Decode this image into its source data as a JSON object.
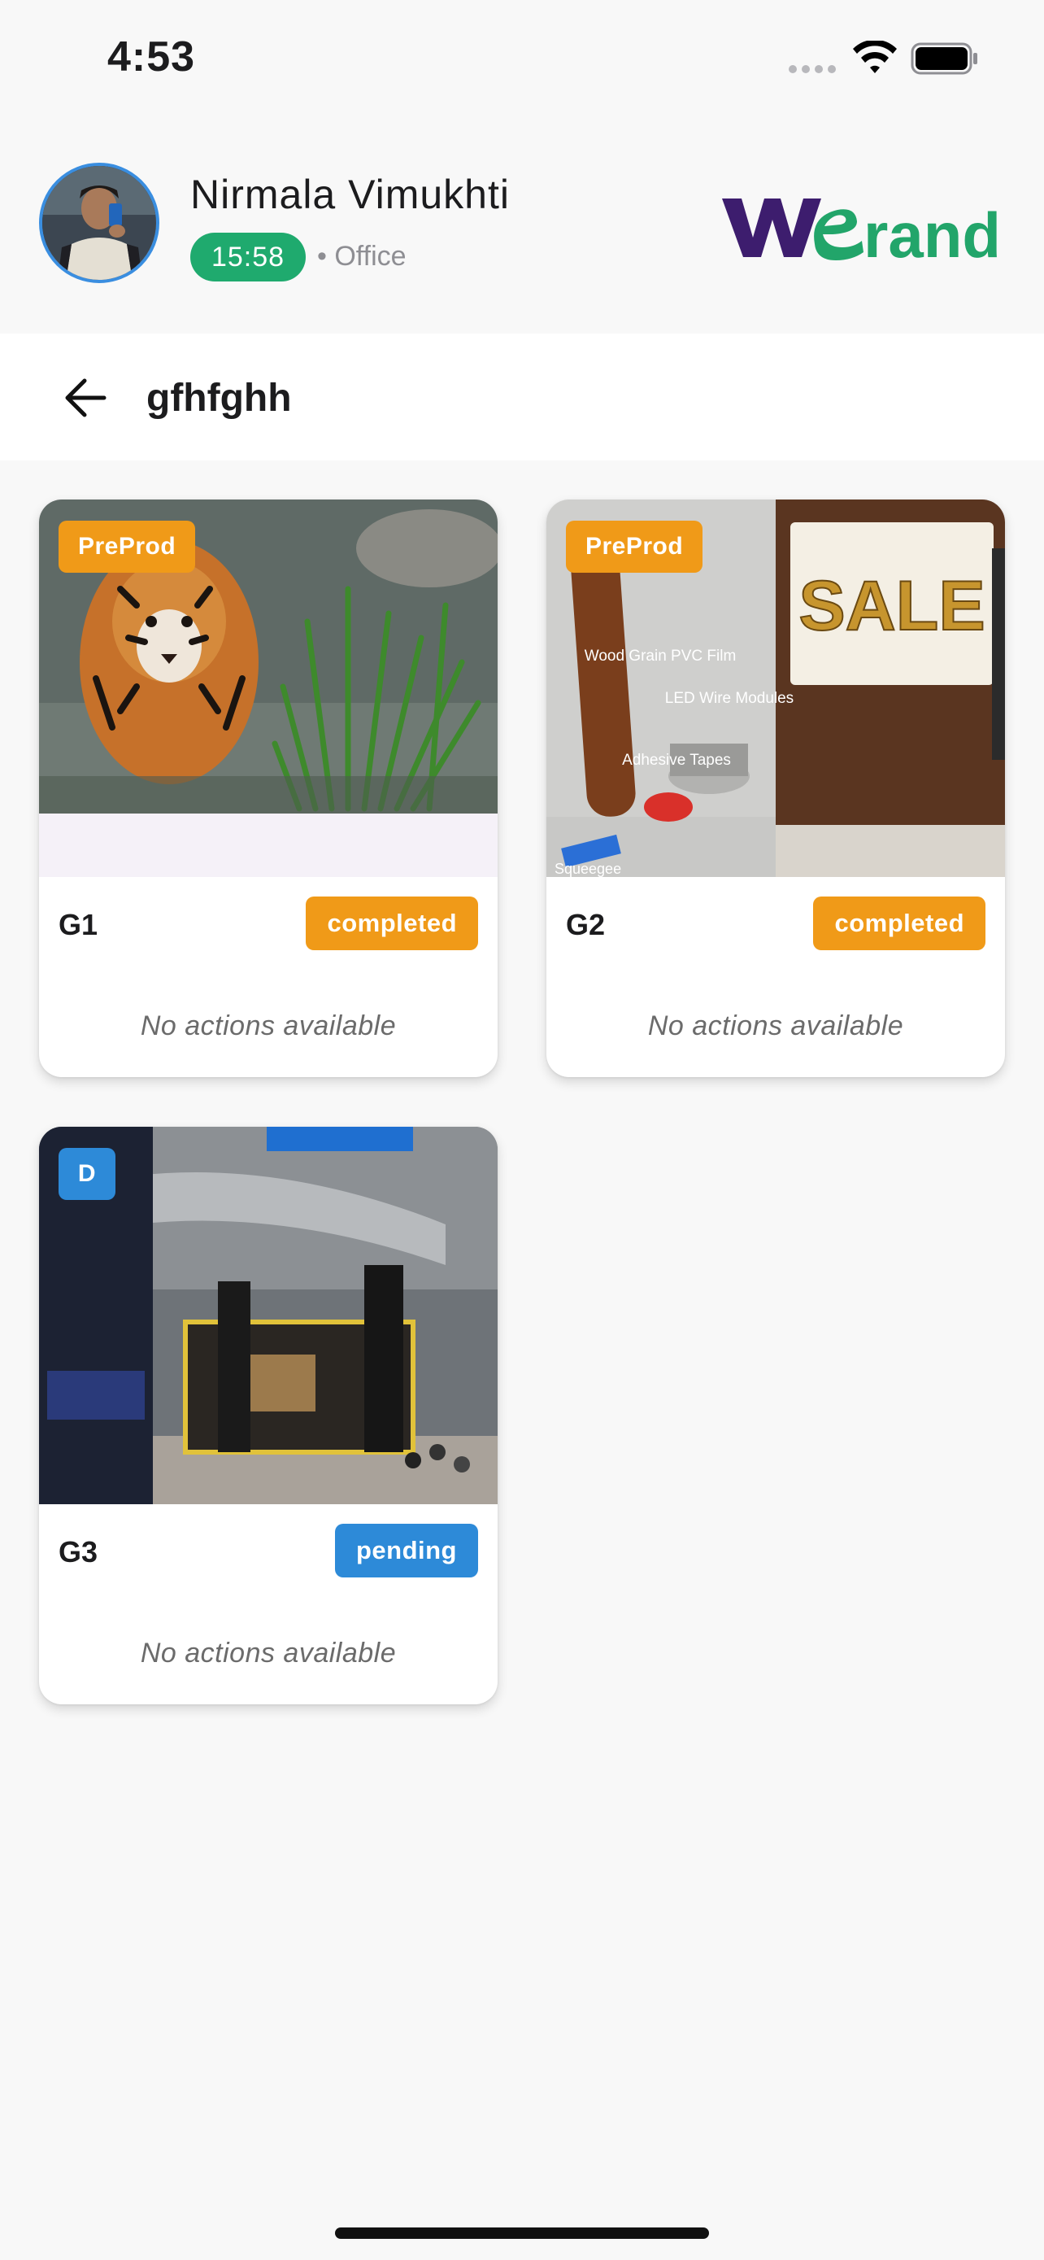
{
  "status_bar": {
    "time": "4:53"
  },
  "profile": {
    "name": "Nirmala Vimukhti",
    "work_time": "15:58",
    "location": "• Office",
    "brand_logo_text": "WeBrand",
    "colors": {
      "pill": "#1faa6e",
      "avatar_ring": "#3a8ee0",
      "brand_purple": "#3d1d6e",
      "brand_green": "#22a56a"
    }
  },
  "app_bar": {
    "title": "gfhfghh",
    "back_icon": "arrow-left-icon"
  },
  "cards": [
    {
      "stage": "PreProd",
      "title": "G1",
      "status": "completed",
      "actions_text": "No actions available",
      "image": "tiger-in-water",
      "stage_color": "#f09a18",
      "status_color": "#f09a18"
    },
    {
      "stage": "PreProd",
      "title": "G2",
      "status": "completed",
      "actions_text": "No actions available",
      "image": "materials-and-sale-sign",
      "image_labels": [
        "Wood Grain PVC Film",
        "LED Wire Modules",
        "Adhesive Tapes",
        "Squeegee",
        "SALE"
      ],
      "stage_color": "#f09a18",
      "status_color": "#f09a18"
    },
    {
      "stage": "D",
      "title": "G3",
      "status": "pending",
      "actions_text": "No actions available",
      "image": "airshow-exhibition-booth",
      "stage_color": "#2d8ad8",
      "status_color": "#2d8ad8"
    }
  ]
}
